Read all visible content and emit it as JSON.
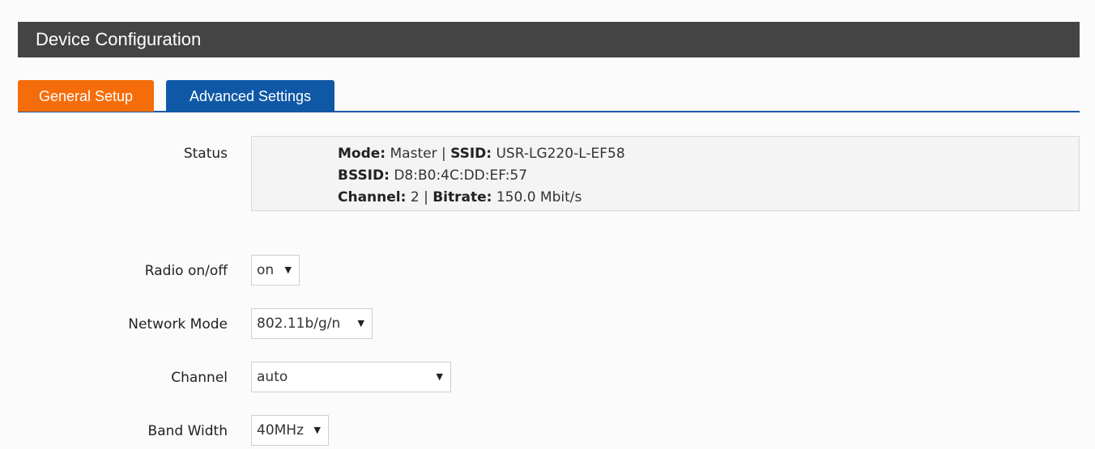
{
  "header": {
    "title": "Device Configuration"
  },
  "tabs": [
    {
      "label": "General Setup",
      "active": true
    },
    {
      "label": "Advanced Settings",
      "active": false
    }
  ],
  "status": {
    "label": "Status",
    "mode_key": "Mode:",
    "mode_value": "Master",
    "ssid_key": "SSID:",
    "ssid_value": "USR-LG220-L-EF58",
    "bssid_key": "BSSID:",
    "bssid_value": "D8:B0:4C:DD:EF:57",
    "channel_key": "Channel:",
    "channel_value": "2",
    "bitrate_key": "Bitrate:",
    "bitrate_value": "150.0 Mbit/s",
    "separator": "|"
  },
  "fields": {
    "radio": {
      "label": "Radio on/off",
      "value": "on"
    },
    "network_mode": {
      "label": "Network Mode",
      "value": "802.11b/g/n"
    },
    "channel": {
      "label": "Channel",
      "value": "auto"
    },
    "band_width": {
      "label": "Band Width",
      "value": "40MHz"
    }
  },
  "icons": {
    "dropdown": "caret-down-icon"
  },
  "colors": {
    "header_bg": "#444444",
    "active_tab": "#f56d0a",
    "inactive_tab": "#0f58a6",
    "tab_underline": "#1a5aa6"
  }
}
